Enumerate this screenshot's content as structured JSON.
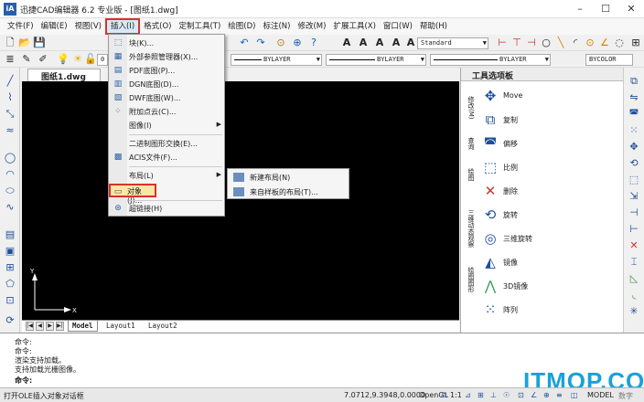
{
  "titlebar": {
    "logo": "iA",
    "title": "迅捷CAD编辑器 6.2 专业版  -  [图纸1.dwg]"
  },
  "menubar": [
    "文件(F)",
    "编辑(E)",
    "视图(V)",
    "插入(I)",
    "格式(O)",
    "定制工具(T)",
    "绘图(D)",
    "标注(N)",
    "修改(M)",
    "扩展工具(X)",
    "窗口(W)",
    "帮助(H)"
  ],
  "toolbar": {
    "text_style": "Standard",
    "layer_value": "0",
    "linetype1": "BYLAYER",
    "linetype2": "BYLAYER",
    "lineweight": "BYLAYER",
    "color": "BYCOLOR"
  },
  "doc_tab": "图纸1.dwg",
  "insert_menu": {
    "items": [
      {
        "label": "块(K)...",
        "icon": "block-icon"
      },
      {
        "label": "外部参照管理器(X)...",
        "icon": "xref-icon"
      },
      {
        "label": "PDF底图(P)...",
        "icon": "pdf-icon"
      },
      {
        "label": "DGN底图(D)...",
        "icon": "dgn-icon"
      },
      {
        "label": "DWF底图(W)...",
        "icon": "dwf-icon"
      },
      {
        "label": "附加点云(C)...",
        "icon": "pointcloud-icon"
      },
      {
        "label": "图像(I)",
        "icon": ""
      },
      {
        "label": "二进制图形交换(E)...",
        "icon": ""
      },
      {
        "label": "ACIS文件(F)...",
        "icon": "acis-icon"
      },
      {
        "label": "布局(L)",
        "icon": ""
      },
      {
        "label": "对象(J)...",
        "icon": "object-icon"
      },
      {
        "label": "超链接(H)",
        "icon": "hyperlink-icon"
      }
    ]
  },
  "layout_submenu": [
    "新建布局(N)",
    "来自样板的布局(T)..."
  ],
  "layout_tabs": [
    "Model",
    "Layout1",
    "Layout2"
  ],
  "palette": {
    "title": "工具选项板",
    "vtabs": [
      "修改(M)",
      "查询",
      "绘图",
      "三维动态观察",
      "绘图图形"
    ],
    "items": [
      "Move",
      "复制",
      "偏移",
      "比例",
      "删除",
      "旋转",
      "三维旋转",
      "镜像",
      "3D镜像",
      "阵列"
    ]
  },
  "command_lines": [
    "命令:",
    "命令:",
    "渲染支持加载。",
    "支持加载光栅图像。",
    "命令:"
  ],
  "status": {
    "message": "打开OLE插入对象对话框",
    "coords": "7.0712,9.3948,0.0000",
    "opengl": "OpenGL",
    "scale": "1:1",
    "model": "MODEL",
    "extra": "数字"
  },
  "watermark": "ITMOP.COM",
  "colors": {
    "accent_red": "#d9302b",
    "canvas": "#000000",
    "highlight": "#fbe6a6"
  }
}
